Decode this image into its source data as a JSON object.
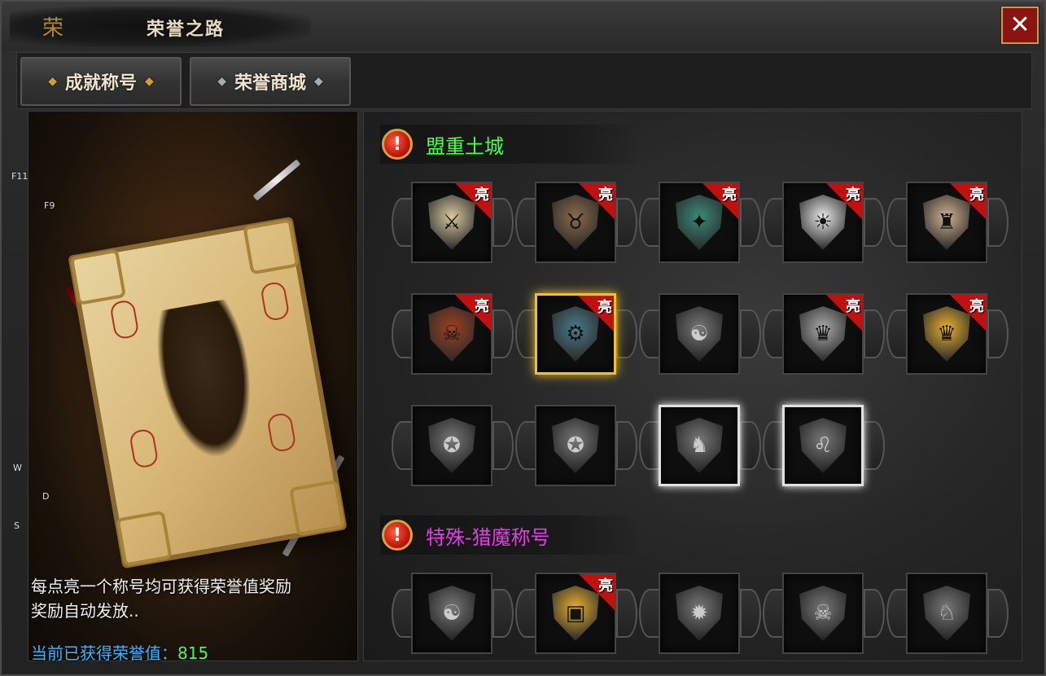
{
  "window": {
    "title": "荣誉之路",
    "logo": "荣",
    "close_label": "✕"
  },
  "tabs": [
    {
      "label": "成就称号",
      "active": true
    },
    {
      "label": "荣誉商城",
      "active": false
    }
  ],
  "side_keys": [
    "F11",
    "F9",
    "W",
    "D",
    "S"
  ],
  "left_panel": {
    "info_line1": "每点亮一个称号均可获得荣誉值奖励",
    "info_line2": "奖励自动发放..",
    "honor_label": "当前已获得荣誉值：",
    "honor_value": "815"
  },
  "sections": [
    {
      "title": "盟重土城",
      "title_color": "#4cff4c",
      "rows": [
        [
          {
            "icon": "sword-shield-icon",
            "lit": true,
            "badge": "亮"
          },
          {
            "icon": "bull-skull-shield-icon",
            "lit": true,
            "badge": "亮"
          },
          {
            "icon": "beetle-shield-icon",
            "lit": true,
            "badge": "亮"
          },
          {
            "icon": "silver-sun-shield-icon",
            "lit": true,
            "badge": "亮"
          },
          {
            "icon": "carousel-shield-icon",
            "lit": true,
            "badge": "亮"
          }
        ],
        [
          {
            "icon": "demon-face-shield-icon",
            "lit": true,
            "badge": "亮"
          },
          {
            "icon": "gear-eye-shield-icon",
            "lit": true,
            "badge": "亮",
            "highlight": "gold"
          },
          {
            "icon": "yin-yang-shield-icon",
            "lit": false,
            "badge": ""
          },
          {
            "icon": "golden-wing-crest-icon",
            "lit": true,
            "badge": "亮"
          },
          {
            "icon": "golden-wing-crest-icon",
            "lit": true,
            "badge": "亮"
          }
        ],
        [
          {
            "icon": "wolf-shield-icon",
            "lit": false,
            "badge": ""
          },
          {
            "icon": "bear-shield-icon",
            "lit": false,
            "badge": ""
          },
          {
            "icon": "dragon-shield-icon",
            "lit": false,
            "badge": "",
            "highlight": "silver"
          },
          {
            "icon": "lion-shield-icon",
            "lit": false,
            "badge": "",
            "highlight": "silver"
          }
        ]
      ]
    },
    {
      "title": "特殊-猎魔称号",
      "title_color": "#e040e0",
      "rows": [
        [
          {
            "icon": "yin-yang-shield-icon",
            "lit": false,
            "badge": ""
          },
          {
            "icon": "chest-shield-icon",
            "lit": true,
            "badge": "亮"
          },
          {
            "icon": "spiked-sun-shield-icon",
            "lit": false,
            "badge": ""
          },
          {
            "icon": "skull-shield-icon",
            "lit": false,
            "badge": ""
          },
          {
            "icon": "knight-helm-shield-icon",
            "lit": false,
            "badge": ""
          }
        ]
      ]
    }
  ]
}
